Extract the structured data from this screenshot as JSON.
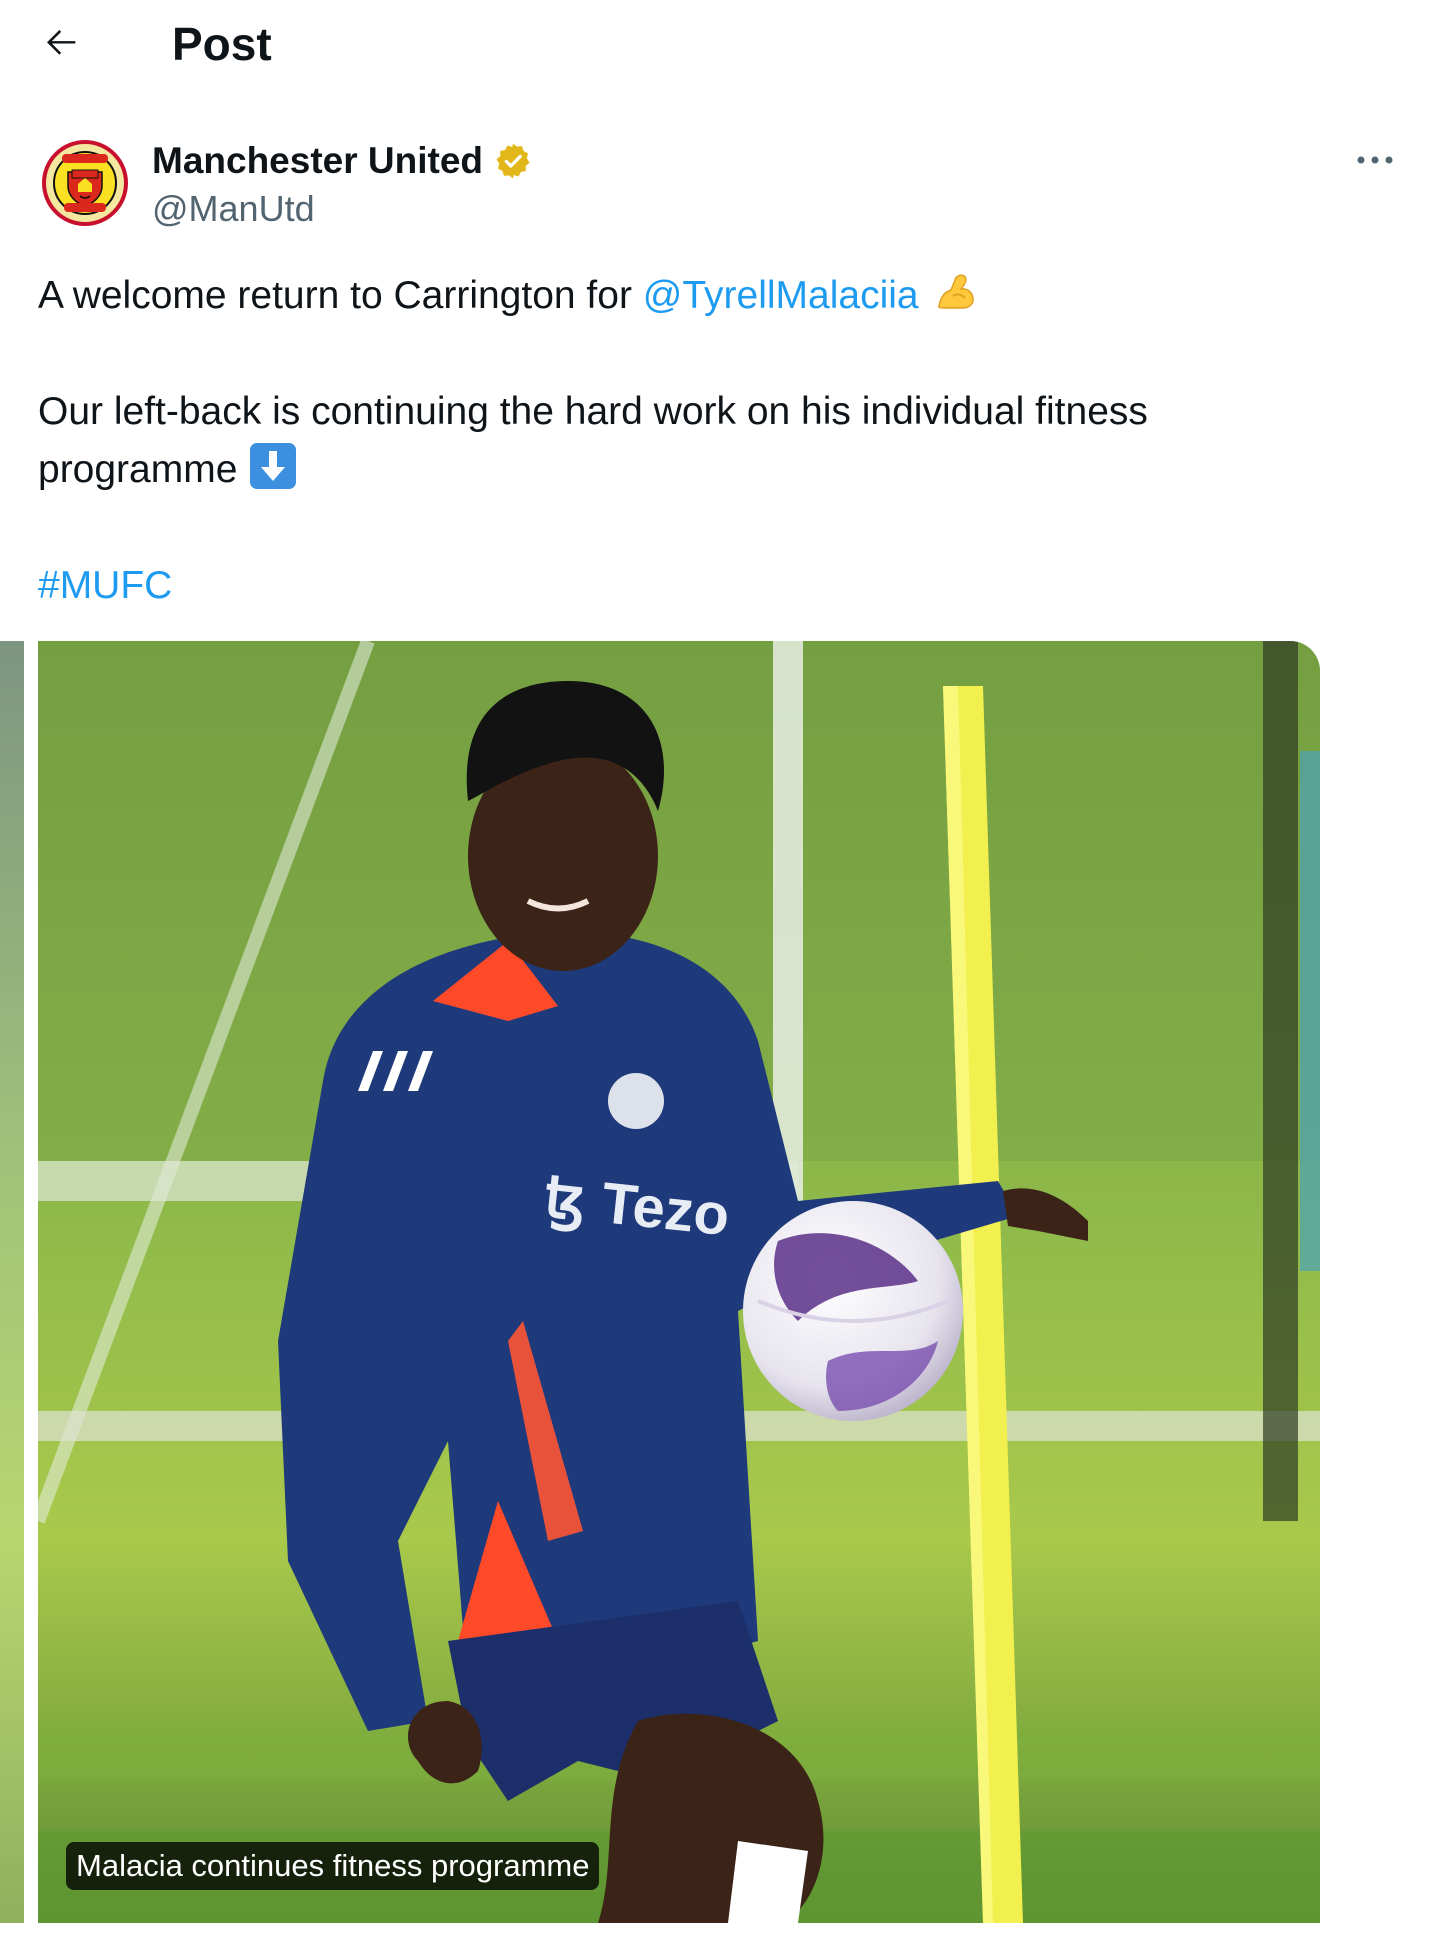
{
  "header": {
    "back_icon": "arrow-left-icon",
    "title": "Post"
  },
  "author": {
    "display_name": "Manchester United",
    "handle": "@ManUtd",
    "verified_icon": "verified-badge-icon",
    "verified_color": "#e2b719",
    "avatar_icon": "manchester-united-crest-icon"
  },
  "tweet": {
    "line1_text": "A welcome return to Carrington for ",
    "mention": "@TyrellMalaciia",
    "line1_emoji": "flexed-biceps-emoji-icon",
    "line2_text": "Our left-back is continuing the hard work on his individual fitness programme",
    "line2_emoji": "down-arrow-emoji-icon",
    "hashtag": "#MUFC",
    "link_color": "#1d9bf0"
  },
  "media": {
    "caption": "Malacia continues fitness programme",
    "shirt_sponsor": "Tezos"
  },
  "more_icon": "more-horizontal-icon"
}
